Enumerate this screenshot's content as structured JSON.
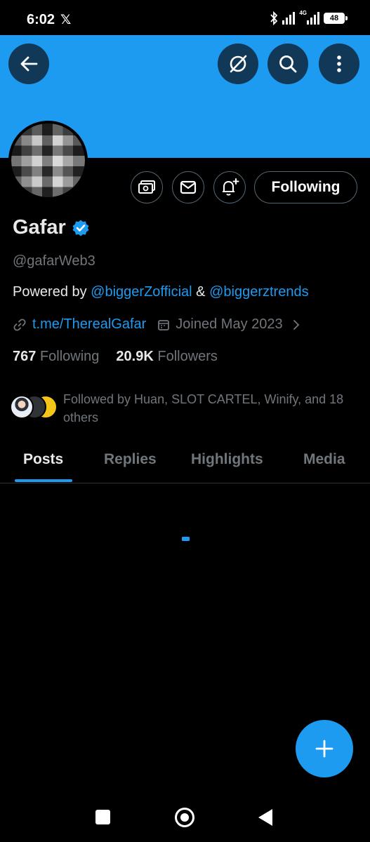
{
  "status_bar": {
    "time": "6:02",
    "network": "4G",
    "battery": "48",
    "icons": [
      "x-logo-icon",
      "bluetooth-icon",
      "signal-icon",
      "signal-4g-icon",
      "battery-icon"
    ]
  },
  "header": {
    "icons": [
      "back-arrow-icon",
      "grok-icon",
      "search-icon",
      "more-vertical-icon"
    ]
  },
  "profile": {
    "name": "Gafar",
    "verified_icon": "verified-badge-icon",
    "handle": "@gafarWeb3",
    "bio_prefix": "Powered by ",
    "bio_mention1": "@biggerZofficial",
    "bio_amp": " & ",
    "bio_mention2": "@biggerztrends",
    "link": "t.me/TherealGafar",
    "joined": "Joined May 2023",
    "following_count": "767",
    "following_label": "Following",
    "followers_count": "20.9K",
    "followers_label": "Followers",
    "followed_by": "Followed by Huan, SLOT CARTEL, Winify, and 18 others"
  },
  "actions": {
    "following_button": "Following",
    "icons": [
      "subscribe-tip-icon",
      "message-icon",
      "notification-bell-add-icon"
    ]
  },
  "tabs": [
    {
      "label": "Posts",
      "active": true
    },
    {
      "label": "Replies",
      "active": false
    },
    {
      "label": "Highlights",
      "active": false
    },
    {
      "label": "Media",
      "active": false
    }
  ],
  "fab": {
    "icon": "plus-icon"
  },
  "nav_bar": {
    "icons": [
      "recents-square-icon",
      "home-circle-icon",
      "back-triangle-icon"
    ]
  },
  "colors": {
    "accent": "#1d9bf0",
    "background": "#000000",
    "muted": "#71767b",
    "text": "#e7e9ea"
  }
}
